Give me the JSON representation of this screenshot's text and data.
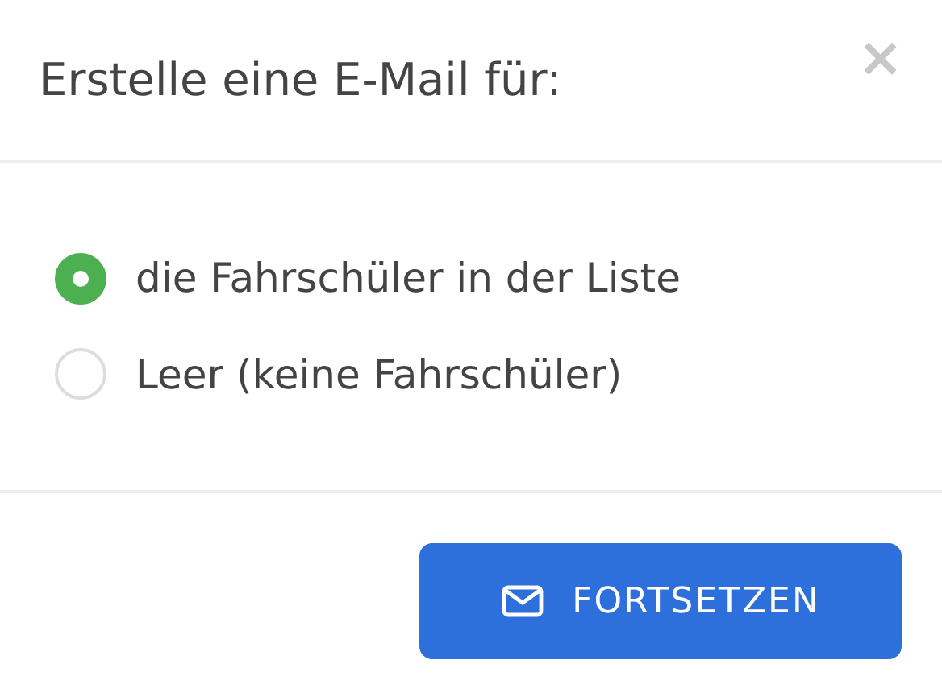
{
  "dialog": {
    "title": "Erstelle eine E-Mail für:",
    "close": "×"
  },
  "options": [
    {
      "label": "die Fahrschüler in der Liste",
      "selected": true
    },
    {
      "label": "Leer (keine Fahrschüler)",
      "selected": false
    }
  ],
  "button": {
    "label": "FORTSETZEN"
  }
}
